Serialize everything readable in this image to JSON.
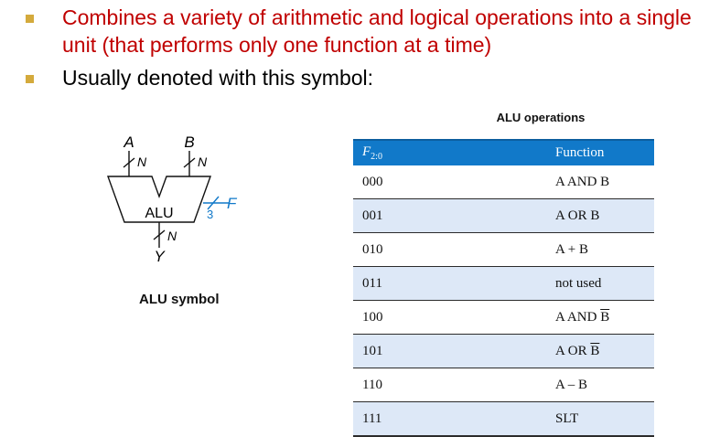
{
  "bullets": [
    {
      "text": "Combines a variety of arithmetic and logical operations into a single unit (that performs only one function at a time)"
    },
    {
      "text": "Usually denoted with this symbol:"
    }
  ],
  "symbol": {
    "input_a": "A",
    "input_b": "B",
    "width_a": "N",
    "width_b": "N",
    "unit_label": "ALU",
    "control_width": "3",
    "control_label": "F",
    "output_width": "N",
    "output_label": "Y",
    "caption": "ALU symbol",
    "control_color": "#1179c9"
  },
  "table": {
    "title": "ALU operations",
    "header_code": "F",
    "header_code_sub": "2:0",
    "header_func": "Function",
    "header_color": "#1179c9",
    "stripe_color": "#dde8f7",
    "rows": [
      {
        "code": "000",
        "func": "A AND B"
      },
      {
        "code": "001",
        "func": "A OR B"
      },
      {
        "code": "010",
        "func": "A + B"
      },
      {
        "code": "011",
        "func": "not used"
      },
      {
        "code": "100",
        "func_pre": "A AND ",
        "func_bar": "B"
      },
      {
        "code": "101",
        "func_pre": "A OR ",
        "func_bar": "B"
      },
      {
        "code": "110",
        "func": "A – B"
      },
      {
        "code": "111",
        "func": "SLT"
      }
    ]
  }
}
